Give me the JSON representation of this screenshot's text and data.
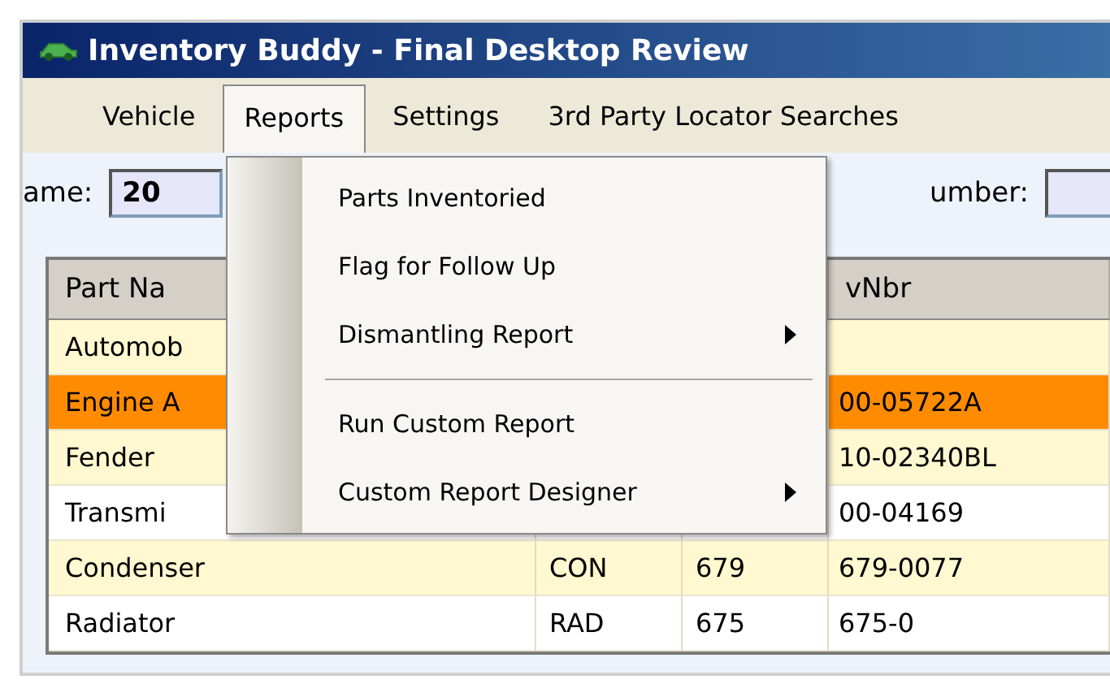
{
  "window": {
    "title": "Inventory Buddy - Final Desktop Review"
  },
  "menu_bar": [
    {
      "label": "Vehicle",
      "selected": false
    },
    {
      "label": "Reports",
      "selected": true
    },
    {
      "label": "Settings",
      "selected": false
    },
    {
      "label": "3rd Party Locator Searches",
      "selected": false
    }
  ],
  "dropdown": [
    {
      "kind": "item",
      "label": "Parts Inventoried",
      "submenu": false
    },
    {
      "kind": "item",
      "label": "Flag for Follow Up",
      "submenu": false
    },
    {
      "kind": "item",
      "label": "Dismantling Report",
      "submenu": true
    },
    {
      "kind": "separator"
    },
    {
      "kind": "item",
      "label": "Run Custom Report",
      "submenu": false
    },
    {
      "kind": "item",
      "label": "Custom Report Designer",
      "submenu": true
    }
  ],
  "form": [
    {
      "label": "ame:",
      "value": "20"
    },
    {
      "label": "umber:"
    }
  ],
  "table": {
    "columns": {
      "column_1": "Part Na",
      "column_4": "vNbr"
    },
    "rows": [
      {
        "cells": [
          "Automob",
          null,
          null,
          null
        ],
        "selected": false
      },
      {
        "cells": [
          "Engine A",
          null,
          null,
          "00-05722A"
        ],
        "selected": true
      },
      {
        "cells": [
          "Fender",
          null,
          null,
          "10-02340BL"
        ],
        "selected": false
      },
      {
        "cells": [
          "Transmi",
          null,
          null,
          "00-04169"
        ],
        "selected": false
      },
      {
        "cells": [
          "Condenser",
          "CON",
          "679",
          "679-0077"
        ],
        "selected": false
      },
      {
        "cells": [
          "Radiator",
          "RAD",
          "675",
          "675-0"
        ],
        "selected": false
      }
    ]
  }
}
